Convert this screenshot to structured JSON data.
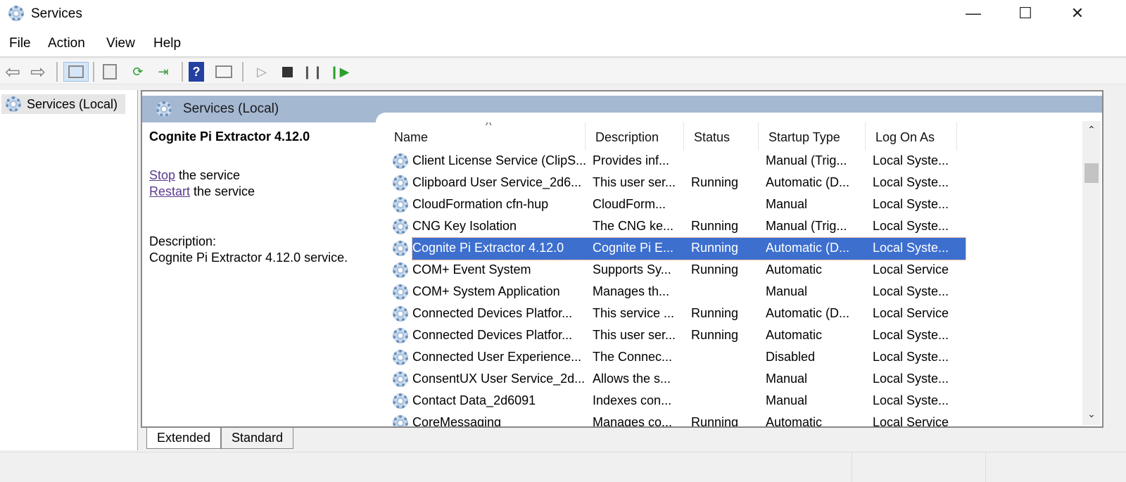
{
  "window": {
    "title": "Services",
    "minimize": "—",
    "maximize": "☐",
    "close": "✕"
  },
  "menu": [
    "File",
    "Action",
    "View",
    "Help"
  ],
  "toolbar": {
    "icons": [
      "back-arrow-icon",
      "forward-arrow-icon",
      "show-hide-console-tree-icon",
      "properties-icon",
      "refresh-icon",
      "export-list-icon",
      "help-icon",
      "show-hide-action-pane-icon",
      "start-service-icon",
      "stop-service-icon",
      "pause-service-icon",
      "restart-service-icon"
    ]
  },
  "tree": {
    "item": "Services (Local)"
  },
  "panel": {
    "header": "Services (Local)",
    "selected_title": "Cognite Pi Extractor 4.12.0",
    "stop_link": "Stop",
    "stop_rest": " the service",
    "restart_link": "Restart",
    "restart_rest": " the service",
    "description_label": "Description:",
    "description_text": "Cognite Pi Extractor 4.12.0 service."
  },
  "columns": [
    "Name",
    "Description",
    "Status",
    "Startup Type",
    "Log On As"
  ],
  "sort_indicator": "^",
  "rows": [
    {
      "name": "Client License Service (ClipS...",
      "description": "Provides inf...",
      "status": "",
      "startup": "Manual (Trig...",
      "logon": "Local Syste..."
    },
    {
      "name": "Clipboard User Service_2d6...",
      "description": "This user ser...",
      "status": "Running",
      "startup": "Automatic (D...",
      "logon": "Local Syste..."
    },
    {
      "name": "CloudFormation cfn-hup",
      "description": "CloudForm...",
      "status": "",
      "startup": "Manual",
      "logon": "Local Syste..."
    },
    {
      "name": "CNG Key Isolation",
      "description": "The CNG ke...",
      "status": "Running",
      "startup": "Manual (Trig...",
      "logon": "Local Syste..."
    },
    {
      "name": "Cognite Pi Extractor 4.12.0",
      "description": "Cognite Pi E...",
      "status": "Running",
      "startup": "Automatic (D...",
      "logon": "Local Syste...",
      "selected": true
    },
    {
      "name": "COM+ Event System",
      "description": "Supports Sy...",
      "status": "Running",
      "startup": "Automatic",
      "logon": "Local Service"
    },
    {
      "name": "COM+ System Application",
      "description": "Manages th...",
      "status": "",
      "startup": "Manual",
      "logon": "Local Syste..."
    },
    {
      "name": "Connected Devices Platfor...",
      "description": "This service ...",
      "status": "Running",
      "startup": "Automatic (D...",
      "logon": "Local Service"
    },
    {
      "name": "Connected Devices Platfor...",
      "description": "This user ser...",
      "status": "Running",
      "startup": "Automatic",
      "logon": "Local Syste..."
    },
    {
      "name": "Connected User Experience...",
      "description": "The Connec...",
      "status": "",
      "startup": "Disabled",
      "logon": "Local Syste..."
    },
    {
      "name": "ConsentUX User Service_2d...",
      "description": "Allows the s...",
      "status": "",
      "startup": "Manual",
      "logon": "Local Syste..."
    },
    {
      "name": "Contact Data_2d6091",
      "description": "Indexes con...",
      "status": "",
      "startup": "Manual",
      "logon": "Local Syste..."
    },
    {
      "name": "CoreMessaging",
      "description": "Manages co...",
      "status": "Running",
      "startup": "Automatic",
      "logon": "Local Service"
    }
  ],
  "tabs": [
    "Extended",
    "Standard"
  ],
  "scroll": {
    "up": "⌃",
    "down": "⌄"
  }
}
